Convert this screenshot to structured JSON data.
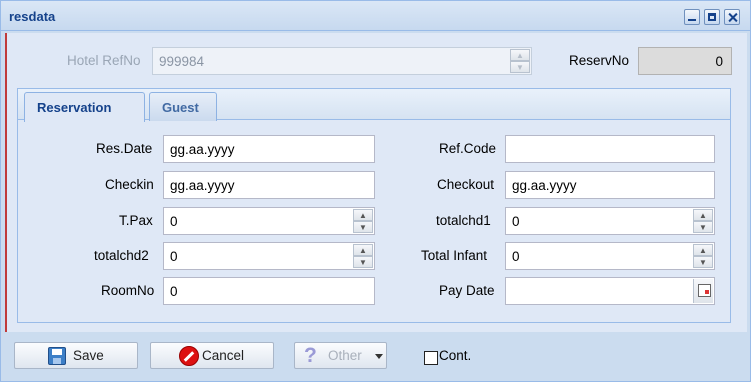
{
  "window": {
    "title": "resdata"
  },
  "header": {
    "hotel_refno_label": "Hotel RefNo",
    "hotel_refno_value": "999984",
    "reservno_label": "ReservNo",
    "reservno_value": "0"
  },
  "tabs": [
    {
      "label": "Reservation",
      "active": true
    },
    {
      "label": "Guest",
      "active": false
    }
  ],
  "form": {
    "res_date": {
      "label": "Res.Date",
      "value": "gg.aa.yyyy"
    },
    "ref_code": {
      "label": "Ref.Code",
      "value": ""
    },
    "checkin": {
      "label": "Checkin",
      "value": "gg.aa.yyyy"
    },
    "checkout": {
      "label": "Checkout",
      "value": "gg.aa.yyyy"
    },
    "tpax": {
      "label": "T.Pax",
      "value": "0"
    },
    "totalchd1": {
      "label": "totalchd1",
      "value": "0"
    },
    "totalchd2": {
      "label": "totalchd2",
      "value": "0"
    },
    "total_infant": {
      "label": "Total Infant",
      "value": "0"
    },
    "roomno": {
      "label": "RoomNo",
      "value": "0"
    },
    "pay_date": {
      "label": "Pay Date",
      "value": ""
    }
  },
  "footer": {
    "save_label": "Save",
    "cancel_label": "Cancel",
    "other_label": "Other",
    "cont_label": "Cont."
  }
}
